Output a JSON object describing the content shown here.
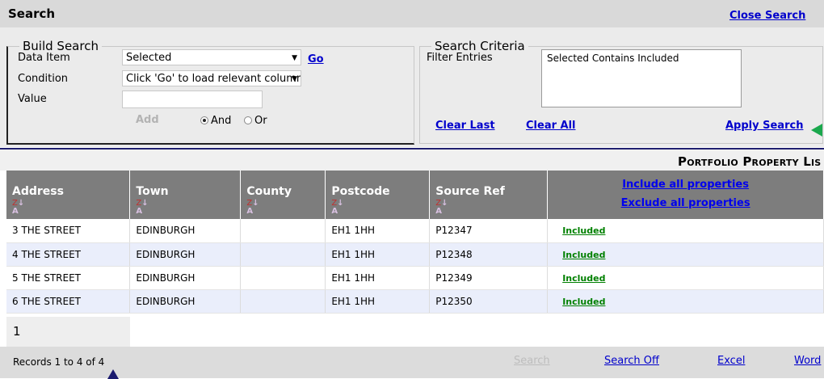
{
  "header": {
    "title": "Search",
    "close_label": "Close Search"
  },
  "build_search": {
    "legend": "Build Search",
    "data_item_label": "Data Item",
    "data_item_value": "Selected",
    "go_label": "Go",
    "condition_label": "Condition",
    "condition_value": "Click 'Go' to load relevant columr",
    "value_label": "Value",
    "value_input": "",
    "add_label": "Add",
    "and_label": "And",
    "or_label": "Or",
    "selected_logic": "And"
  },
  "search_criteria": {
    "legend": "Search Criteria",
    "filter_label": "Filter Entries",
    "filter_entries": [
      "Selected Contains Included"
    ],
    "clear_last_label": "Clear Last",
    "clear_all_label": "Clear All",
    "apply_label": "Apply Search"
  },
  "portfolio_title": "Portfolio Property Lis",
  "table": {
    "columns": [
      "Address",
      "Town",
      "County",
      "Postcode",
      "Source Ref"
    ],
    "include_all_label": "Include all properties",
    "exclude_all_label": "Exclude all properties",
    "rows": [
      {
        "address": "3 THE STREET",
        "town": "EDINBURGH",
        "county": "",
        "postcode": "EH1 1HH",
        "source_ref": "P12347",
        "status": "Included"
      },
      {
        "address": "4 THE STREET",
        "town": "EDINBURGH",
        "county": "",
        "postcode": "EH1 1HH",
        "source_ref": "P12348",
        "status": "Included"
      },
      {
        "address": "5 THE STREET",
        "town": "EDINBURGH",
        "county": "",
        "postcode": "EH1 1HH",
        "source_ref": "P12349",
        "status": "Included"
      },
      {
        "address": "6 THE STREET",
        "town": "EDINBURGH",
        "county": "",
        "postcode": "EH1 1HH",
        "source_ref": "P12350",
        "status": "Included"
      }
    ]
  },
  "pager": {
    "current_page": "1"
  },
  "footer": {
    "records_text": "Records 1 to 4 of 4",
    "search_label": "Search",
    "search_off_label": "Search Off",
    "excel_label": "Excel",
    "word_label": "Word"
  },
  "colors": {
    "accent_link": "#0000cc",
    "included": "#008000",
    "header_bg": "#7d7d7d",
    "arrow_green": "#1aa84d",
    "arrow_navy": "#1a1a6e"
  }
}
